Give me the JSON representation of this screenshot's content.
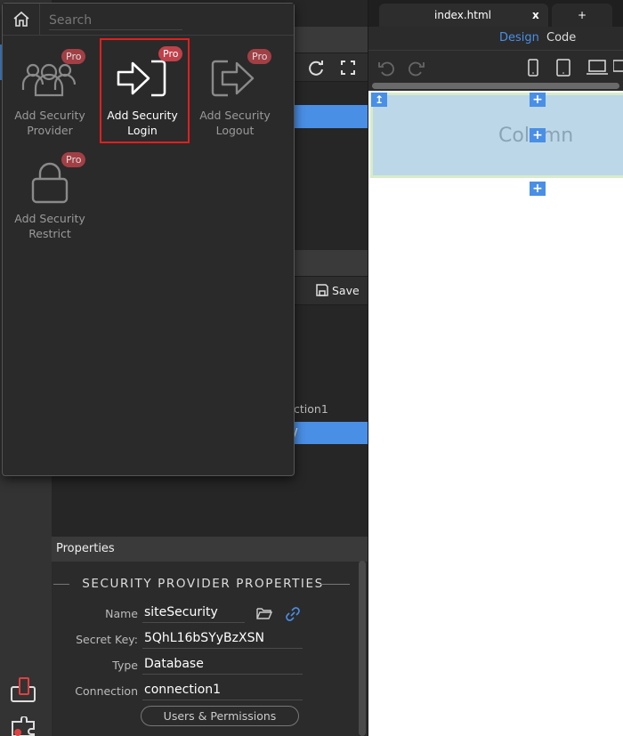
{
  "tabs": {
    "file": "index.html",
    "close": "x",
    "add": "+"
  },
  "view": {
    "design": "Design",
    "code": "Code",
    "active_color": "#4a8fe6"
  },
  "canvas": {
    "column_text": "Column"
  },
  "popup": {
    "search_placeholder": "Search",
    "tools": [
      {
        "label_line1": "Add Security",
        "label_line2": "Provider",
        "badge": "Pro",
        "icon": "users-icon"
      },
      {
        "label_line1": "Add Security",
        "label_line2": "Login",
        "badge": "Pro",
        "icon": "sign-in-icon"
      },
      {
        "label_line1": "Add Security",
        "label_line2": "Logout",
        "badge": "Pro",
        "icon": "sign-out-icon"
      },
      {
        "label_line1": "Add Security",
        "label_line2": "Restrict",
        "badge": "Pro",
        "icon": "lock-icon"
      }
    ],
    "highlight_color": "#e01f1f"
  },
  "leftpanel": {
    "save_label": "Save",
    "partial_item": "ction1",
    "partial_selected": "/"
  },
  "properties": {
    "header": "Properties",
    "section_title": "SECURITY PROVIDER PROPERTIES",
    "name_label": "Name",
    "name_value": "siteSecurity",
    "secret_label": "Secret Key:",
    "secret_value": "5QhL16bSYyBzXSN",
    "type_label": "Type",
    "type_value": "Database",
    "connection_label": "Connection",
    "connection_value": "connection1",
    "users_button": "Users & Permissions"
  }
}
